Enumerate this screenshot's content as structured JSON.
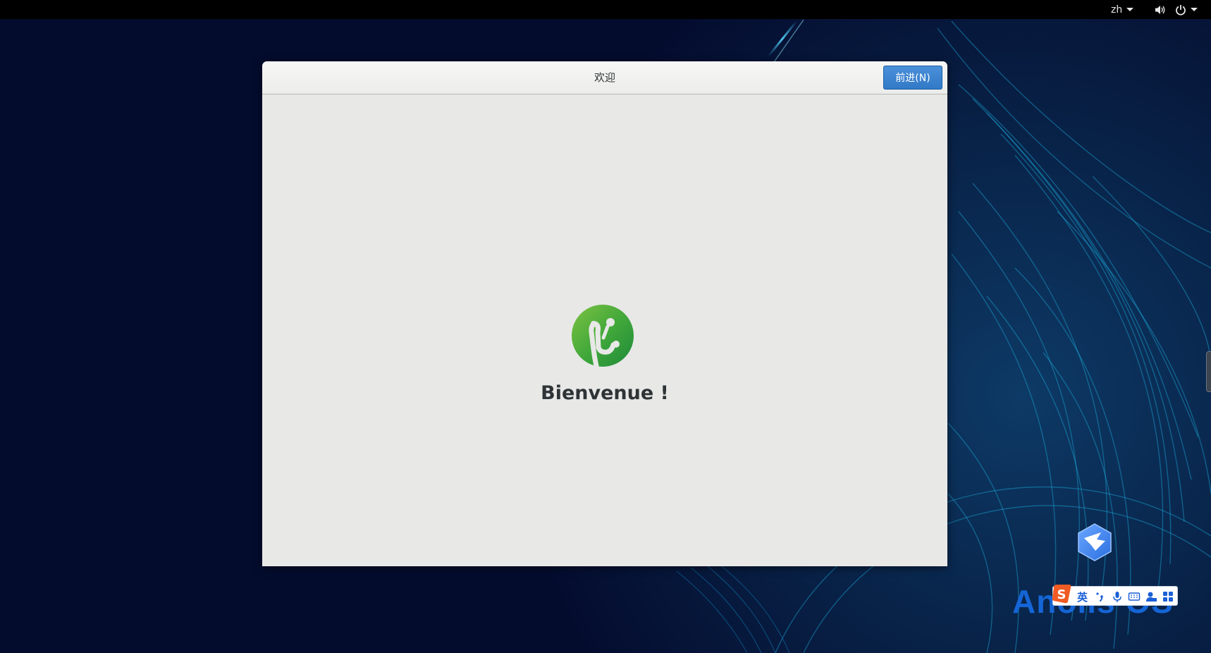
{
  "topbar": {
    "language": "zh",
    "volume_icon": "volume-icon",
    "power_icon": "power-icon"
  },
  "dialog": {
    "title": "欢迎",
    "next_button": "前进(N)",
    "heading": "Bienvenue !",
    "logo_icon": "anolis-leaf-logo"
  },
  "desktop": {
    "brand_text": "Anolis OS",
    "brand_icon": "anolis-bird-logo"
  },
  "ime_toolbar": {
    "logo_icon": "sogou-s-icon",
    "mode_label": "英",
    "buttons": [
      "punctuation-icon",
      "microphone-icon",
      "keyboard-icon",
      "user-icon",
      "grid-icon"
    ]
  },
  "colors": {
    "topbar_bg": "#000000",
    "dialog_bg": "#e8e8e7",
    "button_blue": "#3a84d0",
    "logo_green": "#3ea63a",
    "brand_blue": "#1565d6",
    "desktop_bg": "#040c2e"
  }
}
